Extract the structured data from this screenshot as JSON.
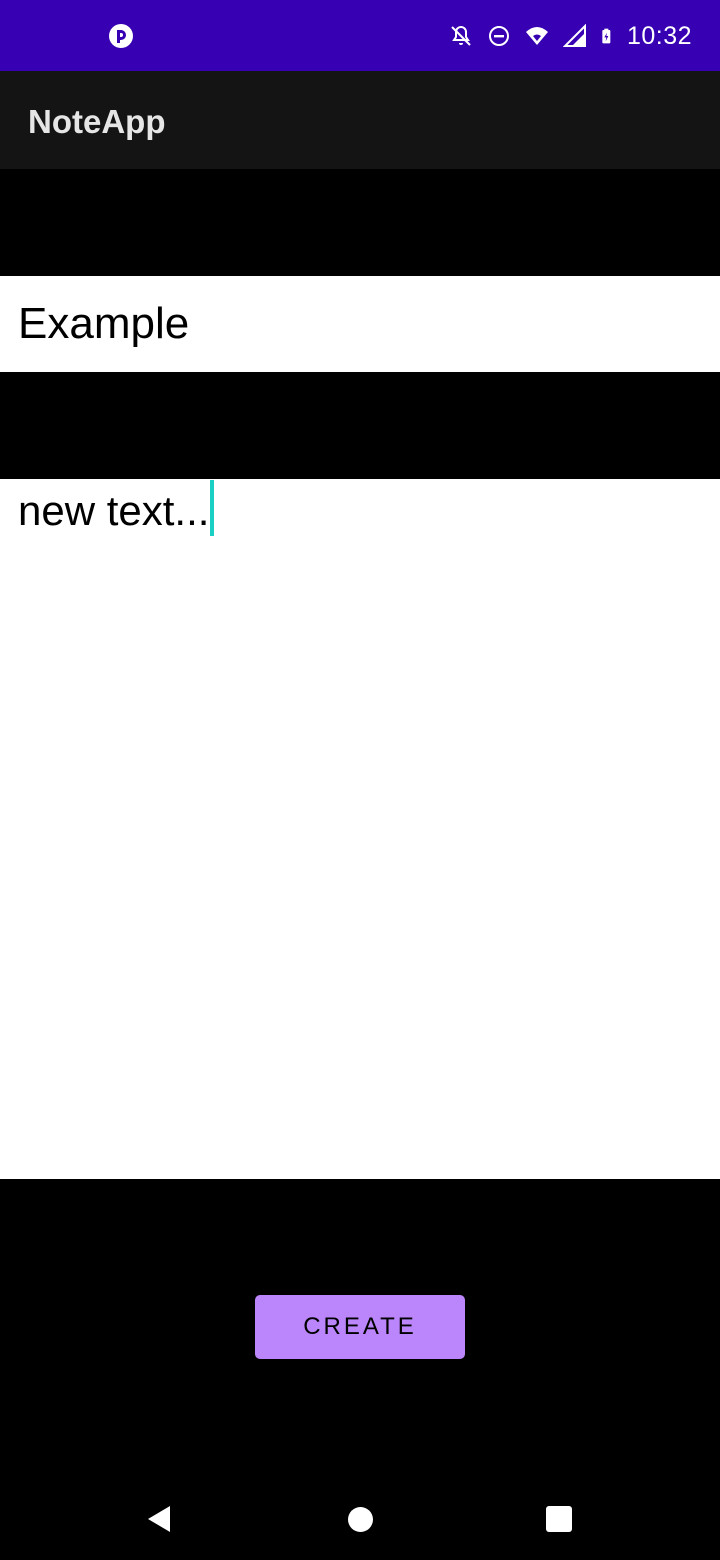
{
  "status_bar": {
    "time": "10:32",
    "left_icon": "app-notification-icon",
    "right_icons": [
      "notifications-off-icon",
      "do-not-disturb-icon",
      "wifi-icon",
      "signal-icon",
      "battery-charging-icon"
    ]
  },
  "app_bar": {
    "title": "NoteApp"
  },
  "note": {
    "title_value": "Example",
    "body_value": "new text..."
  },
  "actions": {
    "create_label": "CREATE"
  },
  "colors": {
    "status_bar": "#3700b3",
    "app_bar": "#141414",
    "background": "#000000",
    "button": "#bb86fc",
    "caret": "#1ccfc4"
  },
  "nav_bar": {
    "icons": [
      "back-icon",
      "home-icon",
      "recents-icon"
    ]
  }
}
